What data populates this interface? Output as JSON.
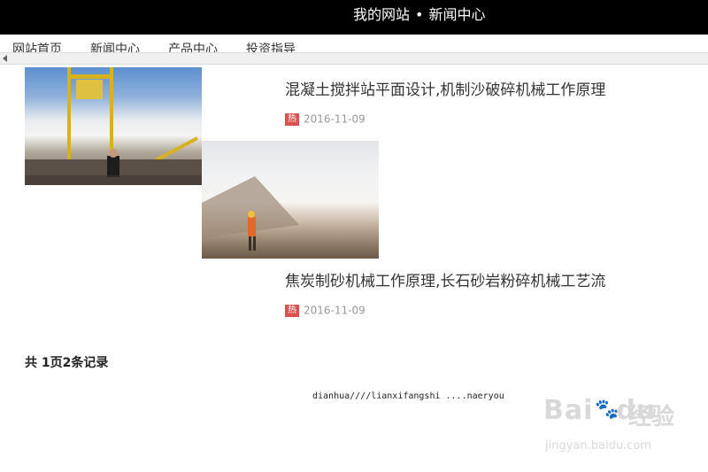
{
  "header": {
    "site_name": "我的网站",
    "separator": "•",
    "section": "新闻中心"
  },
  "nav": {
    "items": [
      {
        "label": "网站首页"
      },
      {
        "label": "新闻中心"
      },
      {
        "label": "产品中心"
      },
      {
        "label": "投资指导"
      }
    ]
  },
  "articles": [
    {
      "title": "混凝土搅拌站平面设计,机制沙破碎机械工作原理",
      "badge": "热",
      "date": "2016-11-09"
    },
    {
      "title": "焦炭制砂机械工作原理,长石砂岩粉碎机械工艺流",
      "badge": "热",
      "date": "2016-11-09"
    }
  ],
  "pagination": {
    "summary": "共 1页2条记录"
  },
  "footer": {
    "text": "dianhua////lianxifangshi ....naeryou"
  },
  "watermark": {
    "brand": "Bai",
    "brand_suffix": "du",
    "cn": "经验",
    "url": "jingyan.baidu.com"
  },
  "colors": {
    "header_bg": "#000000",
    "badge": "#d9534f"
  }
}
